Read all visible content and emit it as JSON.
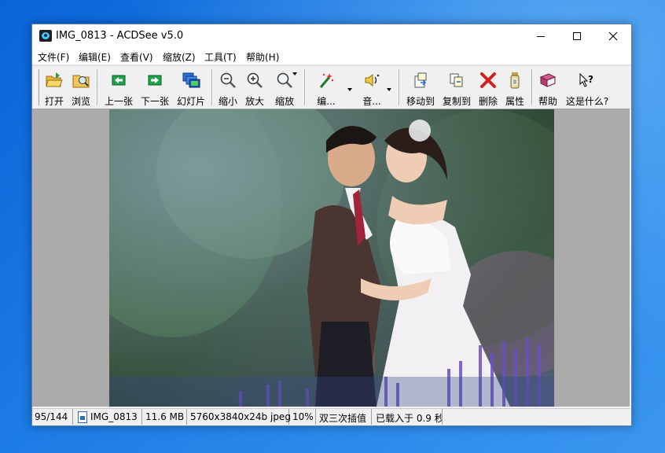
{
  "window": {
    "title": "IMG_0813 - ACDSee v5.0"
  },
  "menu": [
    {
      "label": "文件(F)"
    },
    {
      "label": "编辑(E)"
    },
    {
      "label": "查看(V)"
    },
    {
      "label": "缩放(Z)"
    },
    {
      "label": "工具(T)"
    },
    {
      "label": "帮助(H)"
    }
  ],
  "toolbar": {
    "buttons": [
      {
        "label": "打开",
        "icon": "open-folder-icon"
      },
      {
        "label": "浏览",
        "icon": "browse-icon"
      },
      {
        "label": "上一张",
        "icon": "previous-icon"
      },
      {
        "label": "下一张",
        "icon": "next-icon"
      },
      {
        "label": "幻灯片",
        "icon": "slideshow-icon"
      },
      {
        "label": "缩小",
        "icon": "zoom-out-icon"
      },
      {
        "label": "放大",
        "icon": "zoom-in-icon"
      },
      {
        "label": "缩放",
        "icon": "zoom-icon"
      },
      {
        "label": "编...",
        "icon": "magic-wand-icon"
      },
      {
        "label": "音...",
        "icon": "sound-icon"
      },
      {
        "label": "移动到",
        "icon": "move-to-icon"
      },
      {
        "label": "复制到",
        "icon": "copy-to-icon"
      },
      {
        "label": "删除",
        "icon": "delete-icon"
      },
      {
        "label": "属性",
        "icon": "properties-icon"
      },
      {
        "label": "帮助",
        "icon": "help-book-icon"
      },
      {
        "label": "这是什么?",
        "icon": "whats-this-icon"
      }
    ]
  },
  "status": {
    "index": "95/144",
    "filename": "IMG_0813",
    "filesize": "11.6 MB",
    "dimensions": "5760x3840x24b jpeg",
    "zoom": "10%",
    "interpolation": "双三次插值",
    "load_time": "已载入于 0.9 秒"
  },
  "colors": {
    "desktop": "#1e7ee6",
    "delete_red": "#d21f1f",
    "nav_green": "#1fa34a"
  }
}
